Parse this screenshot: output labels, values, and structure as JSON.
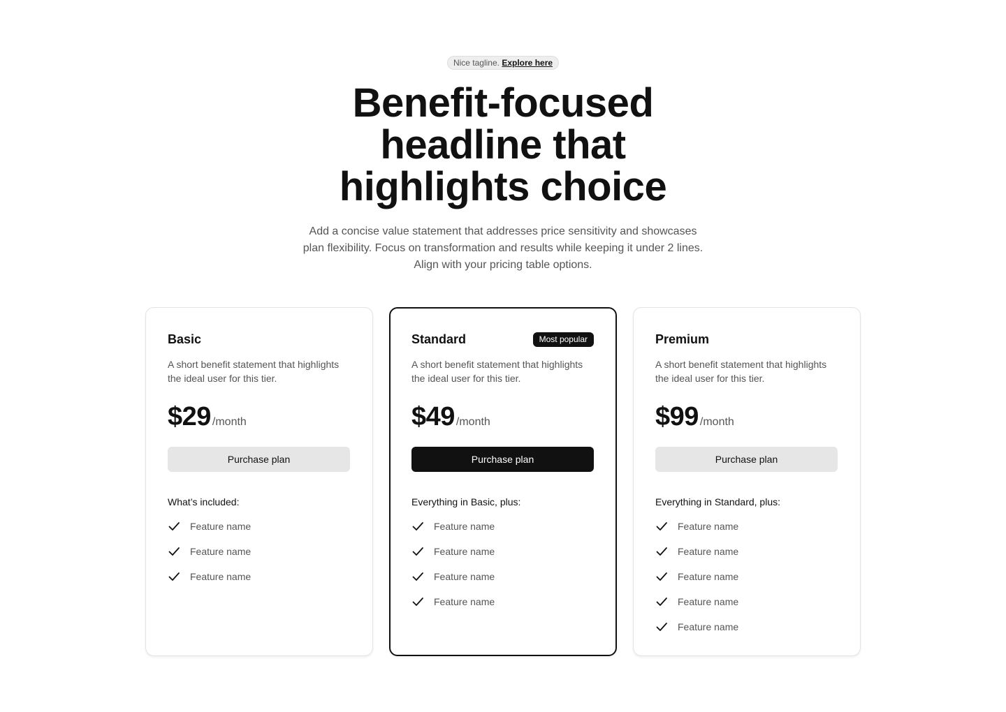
{
  "hero": {
    "tagline_text": "Nice tagline.",
    "tagline_link": "Explore here",
    "headline_lines": [
      "Benefit-focused",
      "headline that",
      "highlights choice"
    ],
    "subtext": "Add a concise value statement that addresses price sensitivity and showcases plan flexibility. Focus on transformation and results while keeping it under 2 lines. Align with your pricing table options."
  },
  "plans": [
    {
      "name": "Basic",
      "badge": "",
      "description": "A short benefit statement that highlights the ideal user for this tier.",
      "price": "$29",
      "period": "/month",
      "button_label": "Purchase plan",
      "included_heading": "What’s included:",
      "features": [
        "Feature name",
        "Feature name",
        "Feature name"
      ]
    },
    {
      "name": "Standard",
      "badge": "Most popular",
      "description": "A short benefit statement that highlights the ideal user for this tier.",
      "price": "$49",
      "period": "/month",
      "button_label": "Purchase plan",
      "included_heading": "Everything in Basic, plus:",
      "features": [
        "Feature name",
        "Feature name",
        "Feature name",
        "Feature name"
      ]
    },
    {
      "name": "Premium",
      "badge": "",
      "description": "A short benefit statement that highlights the ideal user for this tier.",
      "price": "$99",
      "period": "/month",
      "button_label": "Purchase plan",
      "included_heading": "Everything in Standard, plus:",
      "features": [
        "Feature name",
        "Feature name",
        "Feature name",
        "Feature name",
        "Feature name"
      ]
    }
  ],
  "icons": {
    "feature_check": "check-icon"
  },
  "colors": {
    "primary": "#111111",
    "muted_text": "#555555",
    "secondary_button": "#e6e6e6"
  }
}
